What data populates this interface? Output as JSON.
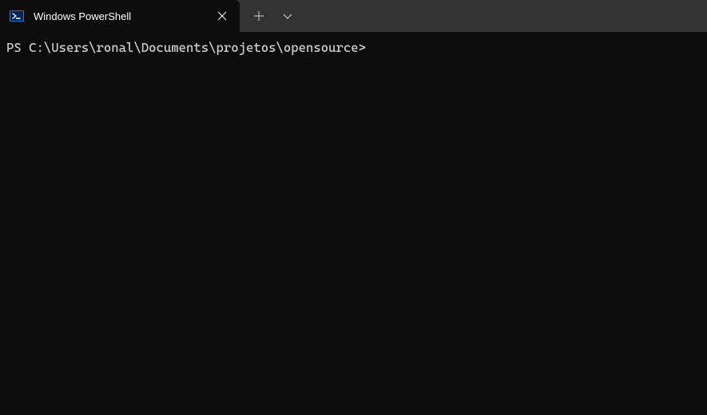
{
  "tab": {
    "title": "Windows PowerShell"
  },
  "terminal": {
    "prompt": "PS C:\\Users\\ronal\\Documents\\projetos\\opensource>"
  }
}
